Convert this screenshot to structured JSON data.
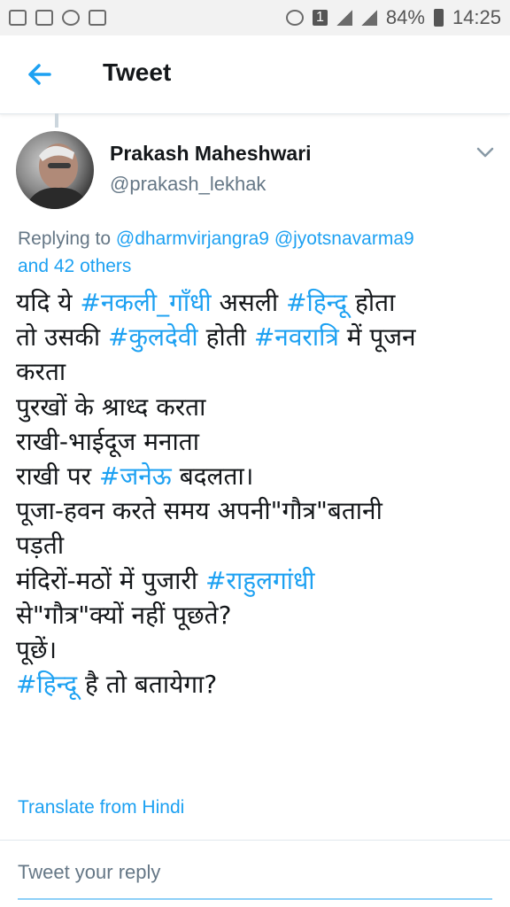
{
  "status_bar": {
    "battery": "84%",
    "time": "14:25",
    "sim": "1"
  },
  "header": {
    "title": "Tweet"
  },
  "tweet": {
    "name": "Prakash Maheshwari",
    "handle": "@prakash_lekhak",
    "replying": {
      "prefix": "Replying to ",
      "mention1": "@dharmvirjangra9",
      "mention2": "@jyotsnavarma9",
      "and": "and 42 others"
    },
    "lines": [
      [
        {
          "t": "यदि ये "
        },
        {
          "t": "#नकली_गाँधी",
          "tag": true
        },
        {
          "t": " असली "
        },
        {
          "t": "#हिन्दू",
          "tag": true
        },
        {
          "t": " होता"
        }
      ],
      [
        {
          "t": "तो उसकी "
        },
        {
          "t": "#कुलदेवी",
          "tag": true
        },
        {
          "t": " होती "
        },
        {
          "t": "#नवरात्रि",
          "tag": true
        },
        {
          "t": " में पूजन"
        }
      ],
      [
        {
          "t": "करता"
        }
      ],
      [
        {
          "t": "पुरखों के श्राध्द करता"
        }
      ],
      [
        {
          "t": "राखी-भाईदूज मनाता"
        }
      ],
      [
        {
          "t": "राखी पर "
        },
        {
          "t": "#जनेऊ",
          "tag": true
        },
        {
          "t": " बदलता।"
        }
      ],
      [
        {
          "t": "पूजा-हवन करते समय अपनी\"गौत्र\"बतानी"
        }
      ],
      [
        {
          "t": "पड़ती"
        }
      ],
      [
        {
          "t": "मंदिरों-मठों में पुजारी "
        },
        {
          "t": "#राहुलगांधी",
          "tag": true
        }
      ],
      [
        {
          "t": "से\"गौत्र\"क्यों नहीं पूछते?"
        }
      ],
      [
        {
          "t": "पूछें।"
        }
      ],
      [
        {
          "t": "#हिन्दू",
          "tag": true
        },
        {
          "t": " है तो बतायेगा?"
        }
      ]
    ],
    "translate": "Translate from Hindi"
  },
  "reply": {
    "placeholder": "Tweet your reply"
  },
  "colors": {
    "accent": "#1da1f2",
    "secondary_text": "#657786"
  }
}
